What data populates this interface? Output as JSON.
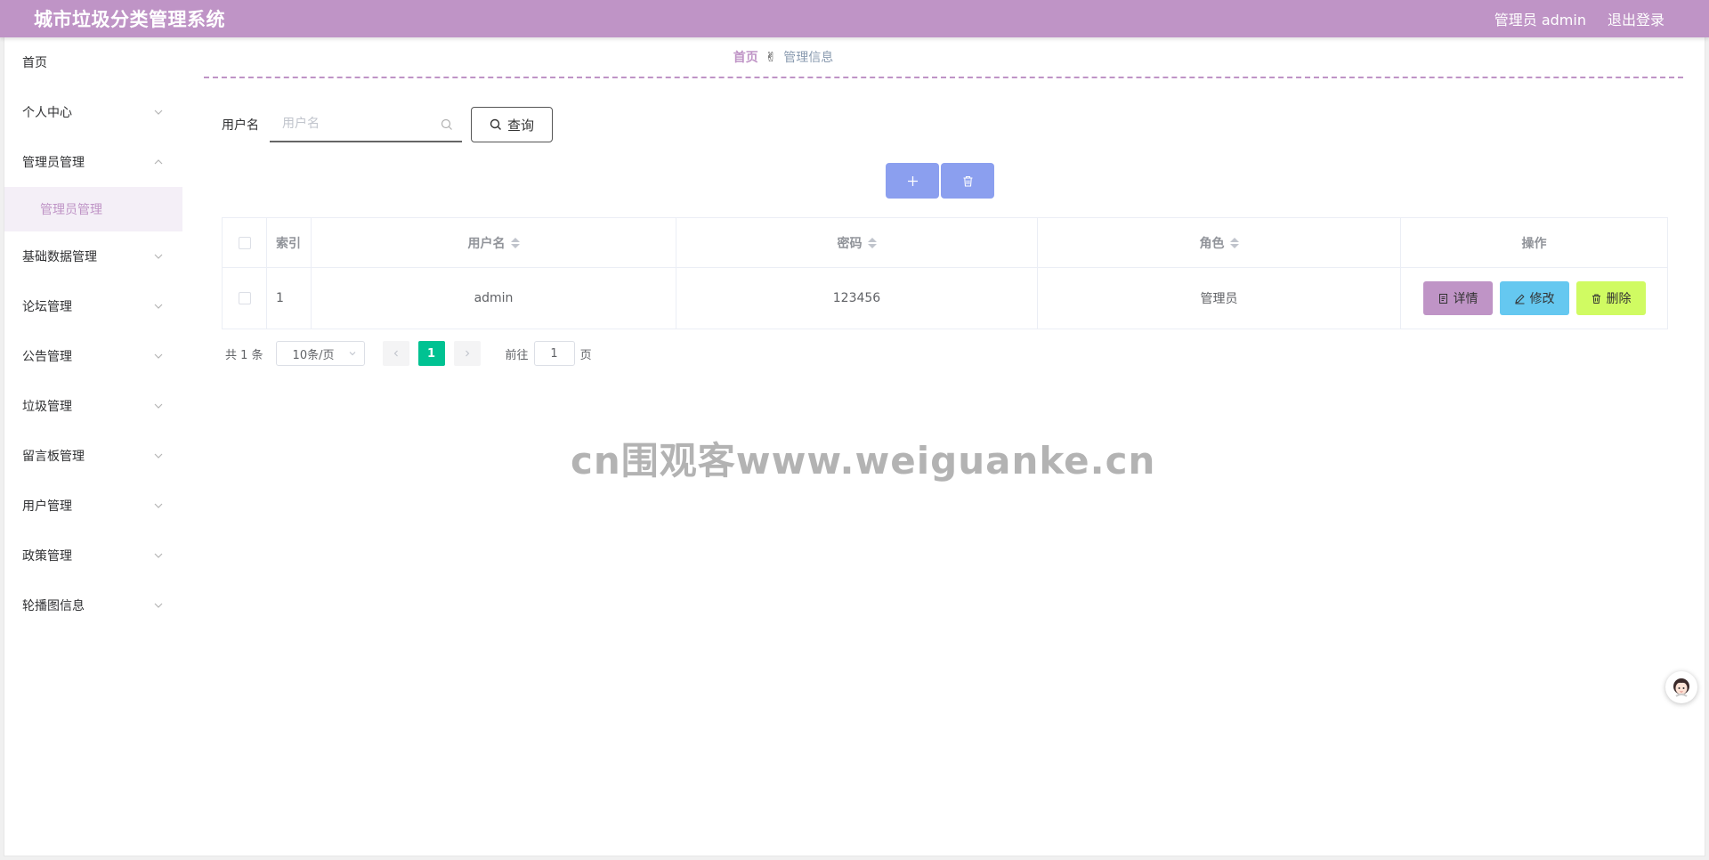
{
  "header": {
    "title": "城市垃圾分类管理系统",
    "user_label": "管理员 admin",
    "logout_label": "退出登录"
  },
  "sidebar": {
    "items": [
      {
        "label": "首页",
        "expanded": false,
        "has_chevron": false
      },
      {
        "label": "个人中心",
        "expanded": false,
        "has_chevron": true
      },
      {
        "label": "管理员管理",
        "expanded": true,
        "has_chevron": true,
        "children": [
          "管理员管理"
        ]
      },
      {
        "label": "基础数据管理",
        "expanded": false,
        "has_chevron": true
      },
      {
        "label": "论坛管理",
        "expanded": false,
        "has_chevron": true
      },
      {
        "label": "公告管理",
        "expanded": false,
        "has_chevron": true
      },
      {
        "label": "垃圾管理",
        "expanded": false,
        "has_chevron": true
      },
      {
        "label": "留言板管理",
        "expanded": false,
        "has_chevron": true
      },
      {
        "label": "用户管理",
        "expanded": false,
        "has_chevron": true
      },
      {
        "label": "政策管理",
        "expanded": false,
        "has_chevron": true
      },
      {
        "label": "轮播图信息",
        "expanded": false,
        "has_chevron": true
      }
    ]
  },
  "breadcrumb": {
    "home": "首页",
    "separator": "✌",
    "current": "管理信息"
  },
  "search": {
    "label": "用户名",
    "placeholder": "用户名",
    "value": "",
    "button_label": "查询"
  },
  "table": {
    "columns": [
      "索引",
      "用户名",
      "密码",
      "角色",
      "操作"
    ],
    "rows": [
      {
        "index": "1",
        "username": "admin",
        "password": "123456",
        "role": "管理员"
      }
    ],
    "actions": {
      "detail": "详情",
      "edit": "修改",
      "delete": "删除"
    }
  },
  "pagination": {
    "total": "共 1 条",
    "page_size": "10条/页",
    "current_page": "1",
    "goto_prefix": "前往",
    "goto_value": "1",
    "goto_suffix": "页"
  },
  "watermark": "cn围观客www.weiguanke.cn",
  "colors": {
    "header": "#bf94c6",
    "accent": "#bf94c6",
    "icon_button": "#8b9fef",
    "detail": "#bf94c6",
    "edit": "#65c8f0",
    "delete": "#d0fb62",
    "page_active": "#00c292"
  }
}
